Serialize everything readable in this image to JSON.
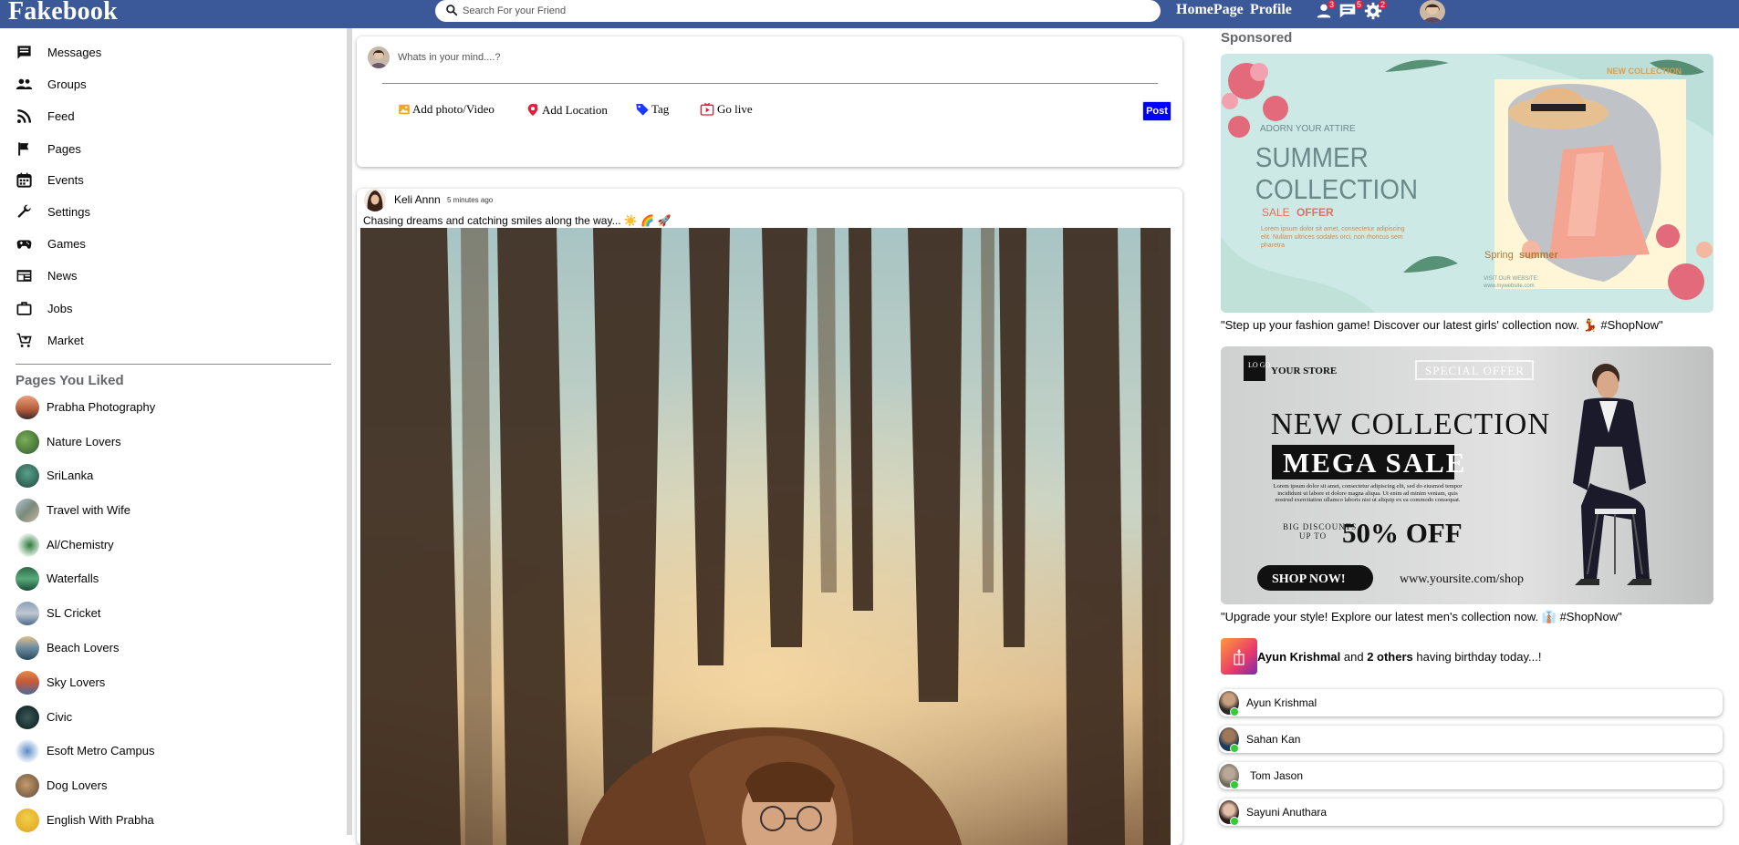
{
  "header": {
    "logo": "Fakebook",
    "search_placeholder": "Search For your Friend",
    "nav": [
      "HomePage",
      "Profile"
    ],
    "badges": {
      "friends": "3",
      "messages": "5",
      "settings": "2"
    }
  },
  "sidebar": {
    "menu": [
      {
        "label": "Messages",
        "icon": "message-icon"
      },
      {
        "label": "Groups",
        "icon": "groups-icon"
      },
      {
        "label": "Feed",
        "icon": "rss-icon"
      },
      {
        "label": "Pages",
        "icon": "flag-icon"
      },
      {
        "label": "Events",
        "icon": "calendar-icon"
      },
      {
        "label": "Settings",
        "icon": "wrench-icon"
      },
      {
        "label": "Games",
        "icon": "gamepad-icon"
      },
      {
        "label": "News",
        "icon": "newspaper-icon"
      },
      {
        "label": "Jobs",
        "icon": "briefcase-icon"
      },
      {
        "label": "Market",
        "icon": "cart-icon"
      }
    ],
    "pages_title": "Pages You Liked",
    "pages": [
      "Prabha Photography",
      "Nature Lovers",
      "SriLanka",
      "Travel with Wife",
      "Al/Chemistry",
      "Waterfalls",
      "SL Cricket",
      "Beach Lovers",
      "Sky Lovers",
      "Civic",
      "Esoft Metro Campus",
      "Dog Lovers",
      "English With Prabha"
    ]
  },
  "composer": {
    "placeholder": "Whats in your mind....?",
    "actions": [
      "Add photo/Video",
      "Add Location",
      "Tag",
      "Go live"
    ],
    "post_label": "Post"
  },
  "post": {
    "author": "Keli Annn",
    "time": "5 minutes ago",
    "caption": "Chasing dreams and catching smiles along the way... ☀️ 🌈 🚀"
  },
  "right": {
    "sponsored_title": "Sponsored",
    "ads": [
      {
        "caption": "\"Step up your fashion game! Discover our latest girls' collection now.  💃 #ShopNow\"",
        "lines": {
          "adorn": "ADORN  YOUR ATTIRE",
          "title1": "SUMMER",
          "title2": "COLLECTION",
          "sale": "SALE",
          "offer": "OFFER",
          "lorem": "Lorem ipsum dolor sit amet, consectetur adipiscing elit. Nullam ultrices sodales orci, non rhoncus sem pharetra",
          "visit": "VISIT OUR WEBSITE:",
          "site": "www.mywebsite.com",
          "new": "NEW COLLECTION",
          "spring": "Spring",
          "summer": "summer"
        }
      },
      {
        "caption": "\"Upgrade your style! Explore our latest men's collection now. 👔 #ShopNow\"",
        "lines": {
          "logo": "LO GO",
          "store": "YOUR STORE",
          "special": "SPECIAL OFFER",
          "newcol": "NEW COLLECTION",
          "mega": "MEGA SALE",
          "lorem": "Lorem ipsum dolor sit amet, consectetur adipiscing elit, sed do eiusmod tempor incididunt ut labore et dolore magna aliqua. Ut enim ad minim veniam, quis nostrud exercitation ullamco laboris nisi ut aliquip ex ea commodo consequat.",
          "big": "BIG DISCOUNTS",
          "upto": "UP TO",
          "pct": "50% OFF",
          "shop": "SHOP NOW!",
          "site": "www.yoursite.com/shop"
        }
      }
    ],
    "birthday": {
      "name": "Ayun Krishmal",
      "and": " and ",
      "others": "2 others",
      "rest": " having birthday today...!"
    },
    "friends": [
      "Ayun Krishmal",
      "Sahan Kan",
      "Tom Jason",
      "Sayuni Anuthara"
    ]
  }
}
